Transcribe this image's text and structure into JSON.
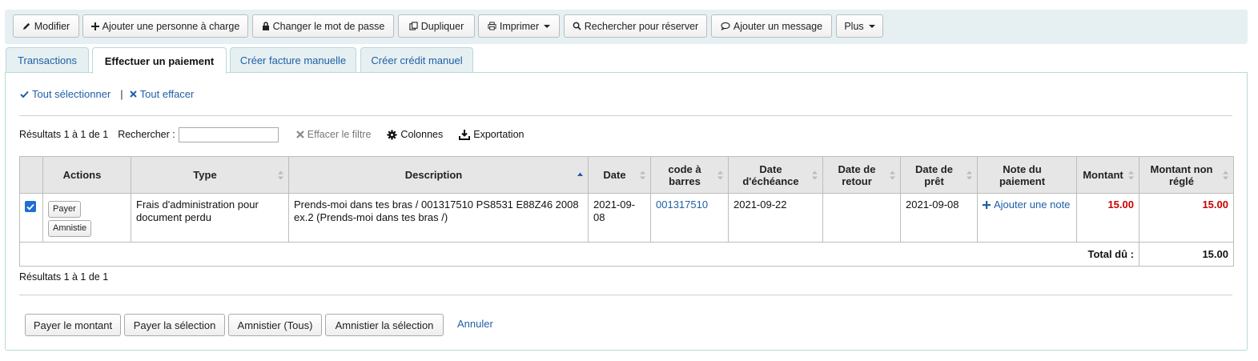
{
  "toolbar": {
    "modify": "Modifier",
    "add_dependent": "Ajouter une personne à charge",
    "change_password": "Changer le mot de passe",
    "duplicate": "Dupliquer",
    "print": "Imprimer",
    "search_to_hold": "Rechercher pour réserver",
    "add_message": "Ajouter un message",
    "more": "Plus"
  },
  "tabs": [
    {
      "label": "Transactions"
    },
    {
      "label": "Effectuer un paiement"
    },
    {
      "label": "Créer facture manuelle"
    },
    {
      "label": "Créer crédit manuel"
    }
  ],
  "selection": {
    "select_all": "Tout sélectionner",
    "separator": "|",
    "clear_all": "Tout effacer"
  },
  "table_tools": {
    "results": "Résultats 1 à 1 de 1",
    "search_label": "Rechercher :",
    "search_value": "",
    "clear_filter": "Effacer le filtre",
    "columns": "Colonnes",
    "export": "Exportation"
  },
  "table": {
    "headers": {
      "actions": "Actions",
      "type": "Type",
      "description": "Description",
      "date": "Date",
      "barcode": "code à barres",
      "due_date": "Date d'échéance",
      "return_date": "Date de retour",
      "loan_date": "Date de prêt",
      "payment_note": "Note du paiement",
      "amount": "Montant",
      "outstanding": "Montant non réglé"
    },
    "row": {
      "checked": true,
      "pay_button": "Payer",
      "writeoff_button": "Amnistie",
      "type": "Frais d'administration pour document perdu",
      "description": "Prends-moi dans tes bras / 001317510 PS8531 E88Z46 2008 ex.2 (Prends-moi dans tes bras /)",
      "date": "2021-09-08",
      "barcode": "001317510",
      "due_date": "2021-09-22",
      "return_date": "",
      "loan_date": "2021-09-08",
      "add_note": "Ajouter une note",
      "amount": "15.00",
      "outstanding": "15.00"
    },
    "footer": {
      "total_label": "Total dû :",
      "total_value": "15.00"
    }
  },
  "results_bottom": "Résultats 1 à 1 de 1",
  "actions": {
    "pay_amount": "Payer le montant",
    "pay_selected": "Payer la sélection",
    "writeoff_all": "Amnistier (Tous)",
    "writeoff_selected": "Amnistier la sélection",
    "cancel": "Annuler"
  },
  "colors": {
    "link": "#1f5fa6",
    "amount_red": "#cc0000",
    "toolbar_bg": "#e6f0f2",
    "checkbox": "#1f6fd0"
  }
}
